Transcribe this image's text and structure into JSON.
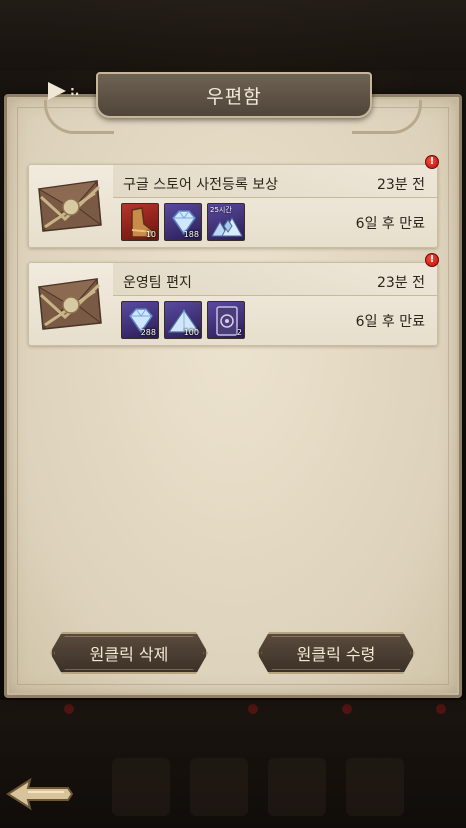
{
  "window": {
    "title": "우편함"
  },
  "top_indicator": {
    "text": ":."
  },
  "mails": [
    {
      "title": "구글 스토어 사전등록 보상",
      "time": "23분 전",
      "expire": "6일 후 만료",
      "alert": "!",
      "rewards": [
        {
          "icon": "red-boots-icon",
          "qty": "10",
          "tag": ""
        },
        {
          "icon": "diamond-icon",
          "qty": "188",
          "tag": ""
        },
        {
          "icon": "diamond-pile-icon",
          "qty": "",
          "tag": "25시간"
        }
      ]
    },
    {
      "title": "운영팀 편지",
      "time": "23분 전",
      "expire": "6일 후 만료",
      "alert": "!",
      "rewards": [
        {
          "icon": "diamond-icon",
          "qty": "288",
          "tag": ""
        },
        {
          "icon": "crystal-pile-icon",
          "qty": "100",
          "tag": ""
        },
        {
          "icon": "card-icon",
          "qty": "2",
          "tag": ""
        }
      ]
    }
  ],
  "buttons": {
    "delete_all": "원클릭 삭제",
    "receive_all": "원클릭 수령"
  },
  "icons": {
    "back": "back-arrow-icon"
  },
  "colors": {
    "alert": "#d0231b",
    "parchment": "#e4dac5",
    "button": "#4a3d31"
  }
}
